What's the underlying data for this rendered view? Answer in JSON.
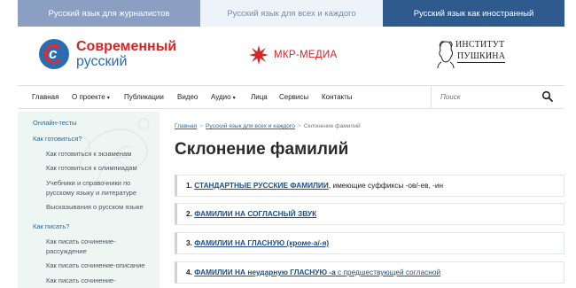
{
  "top_tabs": [
    {
      "label": "Русский язык для журналистов"
    },
    {
      "label": "Русский язык для всех и каждого"
    },
    {
      "label": "Русский язык как иностранный"
    }
  ],
  "logos": {
    "sovremenny": {
      "line1": "Современный",
      "line2": "русский"
    },
    "mkr": {
      "text": "МКР-МЕДИА"
    },
    "pushkin": {
      "line1": "ИНСТИТУТ",
      "line2": "ПУШКИНА"
    }
  },
  "nav": {
    "items": [
      {
        "label": "Главная"
      },
      {
        "label": "О проекте",
        "caret": "▾"
      },
      {
        "label": "Публикации"
      },
      {
        "label": "Видео"
      },
      {
        "label": "Аудио",
        "caret": "▾"
      },
      {
        "label": "Лица"
      },
      {
        "label": "Сервисы"
      },
      {
        "label": "Контакты"
      }
    ],
    "search_placeholder": "Поиск"
  },
  "sidebar": {
    "items": [
      {
        "label": "Онлайн-тесты",
        "level": "h"
      },
      {
        "label": "Как готовиться?",
        "level": "h"
      },
      {
        "label": "Как готовиться к экзаменам",
        "level": "sub"
      },
      {
        "label": "Как готовиться к олимпиадам",
        "level": "sub"
      },
      {
        "label": "Учебники и справочники по русскому языку и литературе",
        "level": "sub"
      },
      {
        "label": "Высказывания о русском языке",
        "level": "sub"
      },
      {
        "label": "Как писать?",
        "level": "h"
      },
      {
        "label": "Как писать сочинение-рассуждение",
        "level": "sub"
      },
      {
        "label": "Как писать сочинение-описание",
        "level": "sub"
      },
      {
        "label": "Как писать сочинение-",
        "level": "sub"
      }
    ]
  },
  "breadcrumb": {
    "home": "Главная",
    "section": "Русский язык для всех и каждого",
    "current": "Склонение фамилий",
    "sep": ">"
  },
  "page_title": "Склонение фамилий",
  "cards": [
    {
      "num": "1.",
      "link": "СТАНДАРТНЫЕ РУССКИЕ ФАМИЛИИ",
      "rest": ", имеющие суффиксы -ов/-ев, -ин"
    },
    {
      "num": "2.",
      "link": "ФАМИЛИИ НА СОГЛАСНЫЙ ЗВУК",
      "rest": ""
    },
    {
      "num": "3.",
      "link": "ФАМИЛИИ НА ГЛАСНУЮ (кроме-а/-я)",
      "rest": ""
    },
    {
      "num": "4.",
      "link": "ФАМИЛИИ НА неударную ГЛАСНУЮ -а",
      "rest2": " с предшествующей согласной"
    }
  ],
  "colors": {
    "tab1": "#8a9fc1",
    "tab2": "#eef3fa",
    "tab3": "#2f5a8d",
    "brand_red": "#d42525",
    "link_blue": "#1f4f86",
    "sidebar_bg": "#eef6f3"
  },
  "icons": {
    "search": "search-icon",
    "mkr_logo": "mkr-star-icon",
    "globe": "globe-logo-icon",
    "portrait": "pushkin-portrait-icon"
  }
}
